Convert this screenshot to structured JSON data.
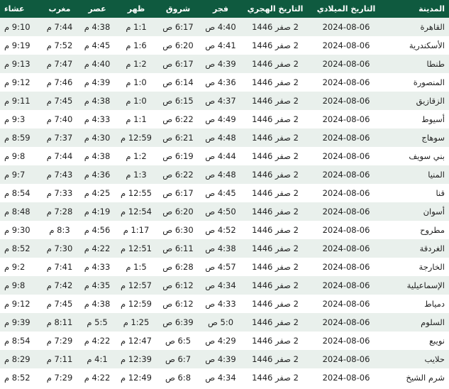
{
  "colors": {
    "header_bg": "#0f5a3f",
    "header_text": "#ffffff",
    "row_alt": "#e9f0ec"
  },
  "table": {
    "headers": [
      "المدينة",
      "التاريخ الميلادي",
      "التاريخ الهجري",
      "فجر",
      "شروق",
      "ظهر",
      "عصر",
      "مغرب",
      "عشاء"
    ],
    "rows": [
      [
        "القاهرة",
        "2024-08-06",
        "2 صفر 1446",
        "4:40 ص",
        "6:17 ص",
        "1:1 م",
        "4:38 م",
        "7:44 م",
        "9:10 م"
      ],
      [
        "الأسكندرية",
        "2024-08-06",
        "2 صفر 1446",
        "4:41 ص",
        "6:20 ص",
        "1:6 م",
        "4:45 م",
        "7:52 م",
        "9:19 م"
      ],
      [
        "طنطا",
        "2024-08-06",
        "2 صفر 1446",
        "4:39 ص",
        "6:17 ص",
        "1:2 م",
        "4:40 م",
        "7:47 م",
        "9:13 م"
      ],
      [
        "المنصورة",
        "2024-08-06",
        "2 صفر 1446",
        "4:36 ص",
        "6:14 ص",
        "1:0 م",
        "4:39 م",
        "7:46 م",
        "9:12 م"
      ],
      [
        "الزقازيق",
        "2024-08-06",
        "2 صفر 1446",
        "4:37 ص",
        "6:15 ص",
        "1:0 م",
        "4:38 م",
        "7:45 م",
        "9:11 م"
      ],
      [
        "أسيوط",
        "2024-08-06",
        "2 صفر 1446",
        "4:49 ص",
        "6:22 ص",
        "1:1 م",
        "4:33 م",
        "7:40 م",
        "9:3 م"
      ],
      [
        "سوهاج",
        "2024-08-06",
        "2 صفر 1446",
        "4:48 ص",
        "6:21 ص",
        "12:59 م",
        "4:30 م",
        "7:37 م",
        "8:59 م"
      ],
      [
        "بني سويف",
        "2024-08-06",
        "2 صفر 1446",
        "4:44 ص",
        "6:19 ص",
        "1:2 م",
        "4:38 م",
        "7:44 م",
        "9:8 م"
      ],
      [
        "المنيا",
        "2024-08-06",
        "2 صفر 1446",
        "4:48 ص",
        "6:22 ص",
        "1:3 م",
        "4:36 م",
        "7:43 م",
        "9:7 م"
      ],
      [
        "قنا",
        "2024-08-06",
        "2 صفر 1446",
        "4:45 ص",
        "6:17 ص",
        "12:55 م",
        "4:25 م",
        "7:33 م",
        "8:54 م"
      ],
      [
        "أسوان",
        "2024-08-06",
        "2 صفر 1446",
        "4:50 ص",
        "6:20 ص",
        "12:54 م",
        "4:19 م",
        "7:28 م",
        "8:48 م"
      ],
      [
        "مطروح",
        "2024-08-06",
        "2 صفر 1446",
        "4:52 ص",
        "6:30 ص",
        "1:17 م",
        "4:56 م",
        "8:3 م",
        "9:30 م"
      ],
      [
        "الغردقة",
        "2024-08-06",
        "2 صفر 1446",
        "4:38 ص",
        "6:11 ص",
        "12:51 م",
        "4:22 م",
        "7:30 م",
        "8:52 م"
      ],
      [
        "الخارجة",
        "2024-08-06",
        "2 صفر 1446",
        "4:57 ص",
        "6:28 ص",
        "1:5 م",
        "4:33 م",
        "7:41 م",
        "9:2 م"
      ],
      [
        "الإسماعيلية",
        "2024-08-06",
        "2 صفر 1446",
        "4:34 ص",
        "6:12 ص",
        "12:57 م",
        "4:35 م",
        "7:42 م",
        "9:8 م"
      ],
      [
        "دمياط",
        "2024-08-06",
        "2 صفر 1446",
        "4:33 ص",
        "6:12 ص",
        "12:59 م",
        "4:38 م",
        "7:45 م",
        "9:12 م"
      ],
      [
        "السلوم",
        "2024-08-06",
        "2 صفر 1446",
        "5:0 ص",
        "6:39 ص",
        "1:25 م",
        "5:5 م",
        "8:11 م",
        "9:39 م"
      ],
      [
        "نويبع",
        "2024-08-06",
        "2 صفر 1446",
        "4:29 ص",
        "6:5 ص",
        "12:47 م",
        "4:22 م",
        "7:29 م",
        "8:54 م"
      ],
      [
        "حلايب",
        "2024-08-06",
        "2 صفر 1446",
        "4:39 ص",
        "6:7 ص",
        "12:39 م",
        "4:1 م",
        "7:11 م",
        "8:29 م"
      ],
      [
        "شرم الشيخ",
        "2024-08-06",
        "2 صفر 1446",
        "4:34 ص",
        "6:8 ص",
        "12:49 م",
        "4:22 م",
        "7:29 م",
        "8:52 م"
      ]
    ]
  }
}
